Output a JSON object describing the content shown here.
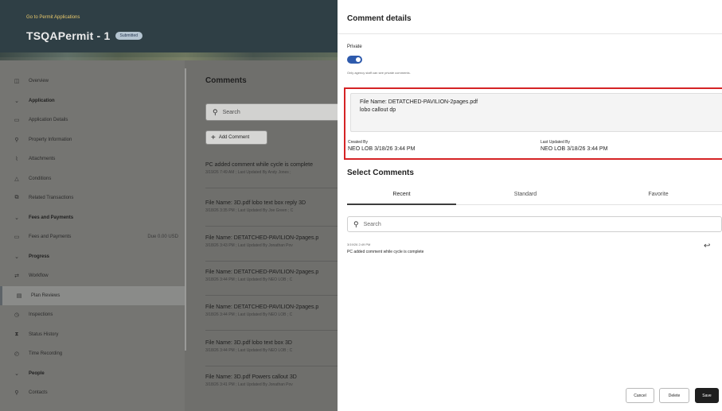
{
  "header": {
    "back_link": "Go to Permit Applications",
    "title": "TSQAPermit - 1",
    "status": "Submitted"
  },
  "sidebar": {
    "items": [
      {
        "label": "Overview",
        "icon": "overview-icon",
        "glyph": "◫",
        "kind": "item"
      },
      {
        "label": "Application",
        "icon": "chevron-down-icon",
        "glyph": "⌄",
        "kind": "section"
      },
      {
        "label": "Application Details",
        "icon": "document-icon",
        "glyph": "▭",
        "kind": "item"
      },
      {
        "label": "Property Information",
        "icon": "person-icon",
        "glyph": "⚲",
        "kind": "item"
      },
      {
        "label": "Attachments",
        "icon": "paperclip-icon",
        "glyph": "⌇",
        "kind": "item"
      },
      {
        "label": "Conditions",
        "icon": "warning-icon",
        "glyph": "△",
        "kind": "item"
      },
      {
        "label": "Related Transactions",
        "icon": "link-icon",
        "glyph": "⧉",
        "kind": "item"
      },
      {
        "label": "Fees and Payments",
        "icon": "chevron-down-icon",
        "glyph": "⌄",
        "kind": "section"
      },
      {
        "label": "Fees and Payments",
        "icon": "card-icon",
        "glyph": "▭",
        "kind": "item",
        "due": "Due 0.00 USD"
      },
      {
        "label": "Progress",
        "icon": "chevron-down-icon",
        "glyph": "⌄",
        "kind": "section"
      },
      {
        "label": "Workflow",
        "icon": "workflow-icon",
        "glyph": "⇄",
        "kind": "item"
      },
      {
        "label": "Plan Reviews",
        "icon": "plan-icon",
        "glyph": "▤",
        "kind": "item",
        "selected": true
      },
      {
        "label": "Inspections",
        "icon": "inspection-icon",
        "glyph": "◷",
        "kind": "item"
      },
      {
        "label": "Status History",
        "icon": "hourglass-icon",
        "glyph": "⧗",
        "kind": "item"
      },
      {
        "label": "Time Recording",
        "icon": "clock-icon",
        "glyph": "◴",
        "kind": "item"
      },
      {
        "label": "People",
        "icon": "chevron-down-icon",
        "glyph": "⌄",
        "kind": "section"
      },
      {
        "label": "Contacts",
        "icon": "person-icon",
        "glyph": "⚲",
        "kind": "item"
      }
    ]
  },
  "comments": {
    "title": "Comments",
    "search_placeholder": "Search",
    "add_label": "Add Comment",
    "items": [
      {
        "title": "PC added comment while cycle is complete",
        "meta": "3/19/26 7:49 AM ; Last Updated By Andy Jones ;"
      },
      {
        "title": "File Name: 3D.pdf lobo text box reply 3D",
        "meta": "3/18/26 3:35 PM ; Last Updated By Joe Green ; C"
      },
      {
        "title": "File Name: DETATCHED-PAVILION-2pages.p",
        "meta": "3/18/26 3:43 PM ; Last Updated By Jonathan Pov"
      },
      {
        "title": "File Name: DETATCHED-PAVILION-2pages.p",
        "meta": "3/18/26 3:44 PM ; Last Updated By NEO LOB ; C"
      },
      {
        "title": "File Name: DETATCHED-PAVILION-2pages.p",
        "meta": "3/18/26 3:44 PM ; Last Updated By NEO LOB ; C"
      },
      {
        "title": "File Name: 3D.pdf lobo text box 3D",
        "meta": "3/18/26 3:44 PM ; Last Updated By NEO LOB ; C"
      },
      {
        "title": "File Name: 3D.pdf Powers callout 3D",
        "meta": "3/18/26 3:41 PM ; Last Updated By Jonathan Pov"
      }
    ]
  },
  "details": {
    "title": "Comment details",
    "private_label": "Private",
    "private_on": true,
    "private_hint": "Only agency staff can see private comments.",
    "file_name": "File Name: DETATCHED-PAVILION-2pages.pdf",
    "file_note": "lobo callout dp",
    "created_by_label": "Created By",
    "created_by_value": "NEO LOB 3/18/26 3:44 PM",
    "updated_by_label": "Last Updated By",
    "updated_by_value": "NEO LOB 3/18/26 3:44 PM",
    "highlight_color": "#d52325"
  },
  "select": {
    "title": "Select Comments",
    "tabs": [
      "Recent",
      "Standard",
      "Favorite"
    ],
    "active_tab": "Recent",
    "search_placeholder": "Search",
    "recent_items": [
      {
        "date": "3/19/26 2:49 PM",
        "text": "PC added comment while cycle is complete"
      }
    ]
  },
  "footer": {
    "cancel": "Cancel",
    "delete": "Delete",
    "save": "Save"
  },
  "colors": {
    "accent": "#2e5aac",
    "header_bg": "#2f3f45",
    "back_link": "#e8c86c"
  }
}
